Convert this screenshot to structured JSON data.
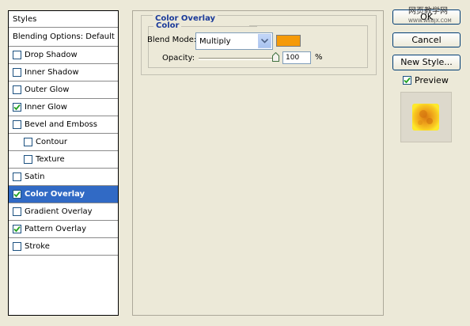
{
  "styles_list": {
    "header": "Styles",
    "blending_options": "Blending Options: Default",
    "items": [
      {
        "label": "Drop Shadow",
        "checked": false,
        "sub": false,
        "selected": false
      },
      {
        "label": "Inner Shadow",
        "checked": false,
        "sub": false,
        "selected": false
      },
      {
        "label": "Outer Glow",
        "checked": false,
        "sub": false,
        "selected": false
      },
      {
        "label": "Inner Glow",
        "checked": true,
        "sub": false,
        "selected": false
      },
      {
        "label": "Bevel and Emboss",
        "checked": false,
        "sub": false,
        "selected": false
      },
      {
        "label": "Contour",
        "checked": false,
        "sub": true,
        "selected": false
      },
      {
        "label": "Texture",
        "checked": false,
        "sub": true,
        "selected": false
      },
      {
        "label": "Satin",
        "checked": false,
        "sub": false,
        "selected": false
      },
      {
        "label": "Color Overlay",
        "checked": true,
        "sub": false,
        "selected": true
      },
      {
        "label": "Gradient Overlay",
        "checked": false,
        "sub": false,
        "selected": false
      },
      {
        "label": "Pattern Overlay",
        "checked": true,
        "sub": false,
        "selected": false
      },
      {
        "label": "Stroke",
        "checked": false,
        "sub": false,
        "selected": false
      }
    ]
  },
  "color_overlay": {
    "group_title": "Color Overlay",
    "subgroup_title": "Color",
    "blend_mode_label": "Blend Mode:",
    "blend_mode_value": "Multiply",
    "overlay_color": "#F59A08",
    "opacity_label": "Opacity:",
    "opacity_value": "100",
    "opacity_unit": "%",
    "opacity_fraction": 1.0
  },
  "buttons": {
    "ok": "OK",
    "cancel": "Cancel",
    "new_style": "New Style..."
  },
  "preview": {
    "label": "Preview",
    "checked": true
  },
  "watermark": {
    "text": "网页教学网",
    "url": "WWW.WEBJX.COM"
  },
  "colors": {
    "selection": "#316AC5",
    "dialog_bg": "#ECE9D8",
    "group_title": "#1A3A9A"
  }
}
